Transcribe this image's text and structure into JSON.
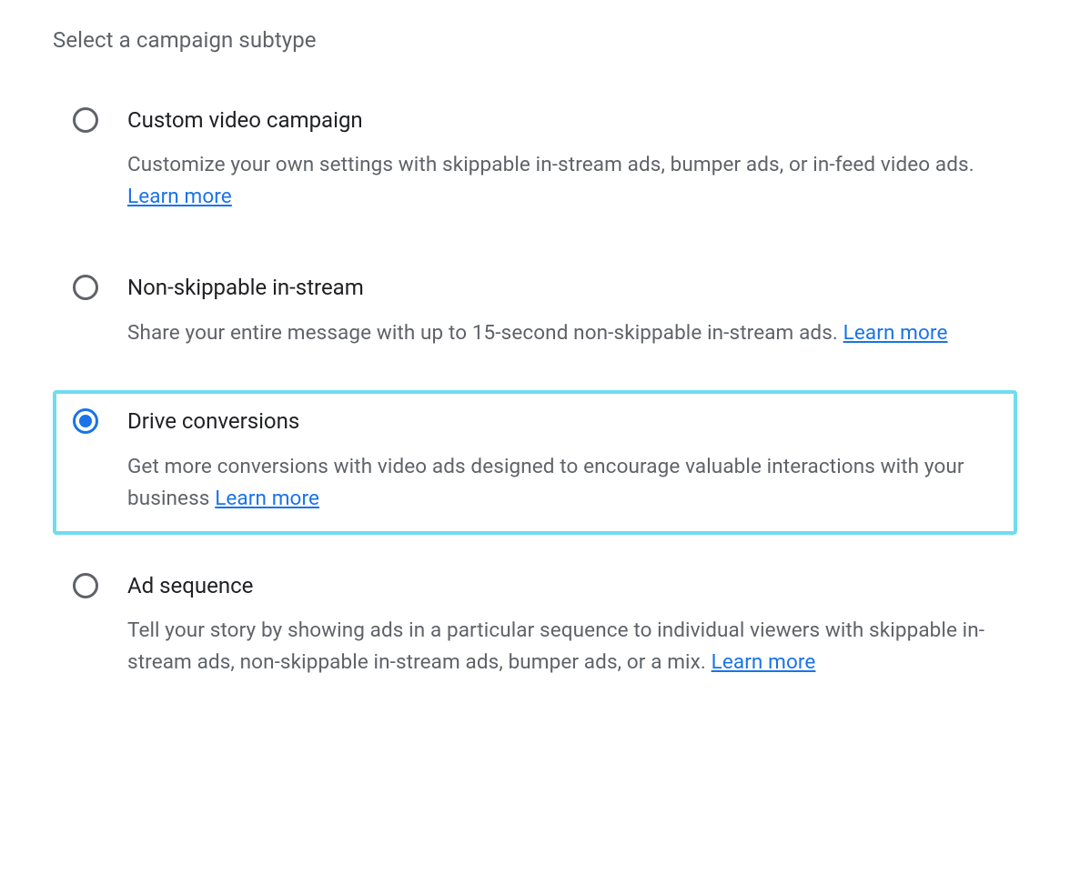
{
  "section": {
    "title": "Select a campaign subtype"
  },
  "learnMoreLabel": "Learn more",
  "options": [
    {
      "id": "custom-video",
      "title": "Custom video campaign",
      "desc": "Customize your own settings with skippable in-stream ads, bumper ads, or in-feed video ads. ",
      "selected": false,
      "highlight": false
    },
    {
      "id": "non-skippable",
      "title": "Non-skippable in-stream",
      "desc": "Share your entire message with up to 15-second non-skippable in-stream ads. ",
      "selected": false,
      "highlight": false
    },
    {
      "id": "drive-conversions",
      "title": "Drive conversions",
      "desc": "Get more conversions with video ads designed to encourage valuable interactions with your business ",
      "selected": true,
      "highlight": true
    },
    {
      "id": "ad-sequence",
      "title": "Ad sequence",
      "desc": "Tell your story by showing ads in a particular sequence to individual viewers with skippable in-stream ads, non-skippable in-stream ads, bumper ads, or a mix. ",
      "selected": false,
      "highlight": false
    }
  ]
}
